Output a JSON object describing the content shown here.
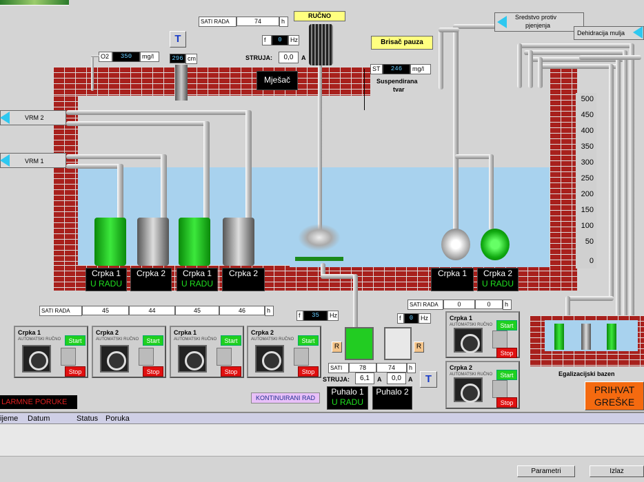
{
  "top": {
    "sati_rada_label": "SATI RADA",
    "sati_rada_value": "74",
    "sati_rada_unit": "h",
    "rucno": "RUČNO",
    "f_label": "f",
    "f_value": "0",
    "f_unit": "Hz",
    "struja_label": "STRUJA:",
    "struja_value": "0,0",
    "struja_unit": "A",
    "brisac": "Brisač pauza",
    "t_label": "T"
  },
  "o2": {
    "label": "O2",
    "value": "350",
    "unit": "mg/l"
  },
  "temp": {
    "value": "296",
    "unit": "cm"
  },
  "st": {
    "label": "ST",
    "value": "246",
    "unit": "mg/l",
    "desc1": "Suspendirana",
    "desc2": "tvar"
  },
  "mjesac": "Mješač",
  "vrm": {
    "vrm2": "VRM 2",
    "vrm1": "VRM 1"
  },
  "right_labels": {
    "sredstvo1": "Sredstvo protiv",
    "sredstvo2": "pjenjenja",
    "dehidracija": "Dehidracija mulja"
  },
  "scale": [
    "500",
    "450",
    "400",
    "350",
    "300",
    "250",
    "200",
    "150",
    "100",
    "50",
    "0"
  ],
  "pumps": [
    {
      "name": "Crpka 1",
      "status": "U RADU"
    },
    {
      "name": "Crpka 2",
      "status": ""
    },
    {
      "name": "Crpka 1",
      "status": "U RADU"
    },
    {
      "name": "Crpka 2",
      "status": ""
    }
  ],
  "right_pumps": [
    {
      "name": "Crpka 1",
      "status": ""
    },
    {
      "name": "Crpka 2",
      "status": "U RADU"
    }
  ],
  "sati_row": {
    "label": "SATI RADA",
    "values": [
      "45",
      "44",
      "45",
      "46"
    ],
    "unit": "h"
  },
  "panels": [
    {
      "title": "Crpka 1",
      "sub": "AUTOMATSKI   RUČNO",
      "start": "Start",
      "stop": "Stop"
    },
    {
      "title": "Crpka 2",
      "sub": "AUTOMATSKI   RUČNO",
      "start": "Start",
      "stop": "Stop"
    },
    {
      "title": "Crpka 1",
      "sub": "AUTOMATSKI   RUČNO",
      "start": "Start",
      "stop": "Stop"
    },
    {
      "title": "Crpka 2",
      "sub": "AUTOMATSKI   RUČNO",
      "start": "Start",
      "stop": "Stop"
    }
  ],
  "right_panels": [
    {
      "title": "Crpka 1",
      "sub": "AUTOMATSKI   RUČNO",
      "start": "Start",
      "stop": "Stop"
    },
    {
      "title": "Crpka 2",
      "sub": "AUTOMATSKI   RUČNO",
      "start": "Start",
      "stop": "Stop"
    }
  ],
  "right_sati": {
    "label": "SATI RADA",
    "v1": "0",
    "v2": "0",
    "unit": "h"
  },
  "blowers": {
    "f1_label": "f",
    "f1_value": "35",
    "f1_unit": "Hz",
    "f2_label": "f",
    "f2_value": "0",
    "f2_unit": "Hz",
    "r": "R",
    "sati_label": "SATI",
    "sati1": "78",
    "sati2": "74",
    "sati_unit": "h",
    "struja_label": "STRUJA:",
    "struja1": "6,1",
    "struja2": "0,0",
    "unit": "A",
    "t_label": "T",
    "b1_name": "Puhalo 1",
    "b1_status": "U RADU",
    "b2_name": "Puhalo 2"
  },
  "egalizacijski": "Egalizacijski bazen",
  "alarm": "LARMNE PORUKE",
  "kontinuirani": "KONTINUIRANI RAD",
  "prihvat1": "PRIHVAT",
  "prihvat2": "GREŠKE",
  "table": {
    "cols": [
      "ijeme",
      "Datum",
      "Status",
      "Poruka"
    ]
  },
  "bottom": {
    "parametri": "Parametri",
    "izlaz": "Izlaz"
  }
}
